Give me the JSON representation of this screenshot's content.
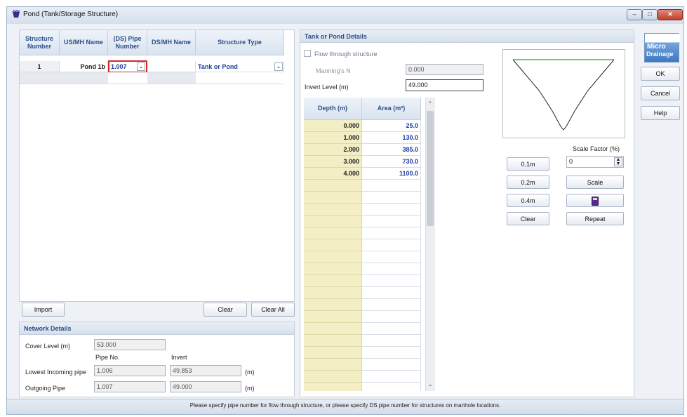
{
  "window": {
    "title": "Pond (Tank/Storage Structure)",
    "min": "–",
    "max": "□",
    "close": "✕"
  },
  "structure_table": {
    "headers": [
      "Structure Number",
      "US/MH Name",
      "(DS) Pipe Number",
      "DS/MH Name",
      "Structure Type"
    ],
    "row": {
      "number": "1",
      "us_mh": "Pond 1b",
      "ds_pipe": "1.007",
      "ds_mh": "",
      "type": "Tank or Pond"
    }
  },
  "buttons": {
    "import": "Import",
    "clear": "Clear",
    "clear_all": "Clear All",
    "ok": "OK",
    "cancel": "Cancel",
    "help": "Help"
  },
  "network": {
    "title": "Network Details",
    "cover_label": "Cover Level (m)",
    "cover_value": "53.000",
    "pipe_no_hdr": "Pipe No.",
    "invert_hdr": "Invert",
    "lowest_label": "Lowest Incoming pipe",
    "lowest_pipe": "1.006",
    "lowest_invert": "49.853",
    "outgoing_label": "Outgoing Pipe",
    "outgoing_pipe": "1.007",
    "outgoing_invert": "49.000",
    "unit": "(m)"
  },
  "pond": {
    "title": "Tank or Pond Details",
    "flow_through": "Flow through structure",
    "mannings_label": "Manning's N",
    "mannings_value": "0.000",
    "invert_label": "Invert Level (m)",
    "invert_value": "49.000",
    "depth_hdr": "Depth (m)",
    "area_hdr": "Area (m²)",
    "rows": [
      {
        "d": "0.000",
        "a": "25.0"
      },
      {
        "d": "1.000",
        "a": "130.0"
      },
      {
        "d": "2.000",
        "a": "385.0"
      },
      {
        "d": "3.000",
        "a": "730.0"
      },
      {
        "d": "4.000",
        "a": "1100.0"
      }
    ]
  },
  "scale": {
    "scale_factor_label": "Scale Factor (%)",
    "scale_factor_value": "0",
    "b01": "0.1m",
    "b02": "0.2m",
    "b04": "0.4m",
    "clear": "Clear",
    "scale": "Scale",
    "repeat": "Repeat"
  },
  "logo": {
    "line1": "Micro",
    "line2": "Drainage"
  },
  "status": "Please specify pipe number for flow through structure, or please specify DS pipe number for structures on manhole locations.",
  "colors": {
    "accent": "#2d4f86",
    "depth_bg": "#f4eec4",
    "link_blue": "#1e3aa0",
    "highlight_border": "#d62828"
  }
}
